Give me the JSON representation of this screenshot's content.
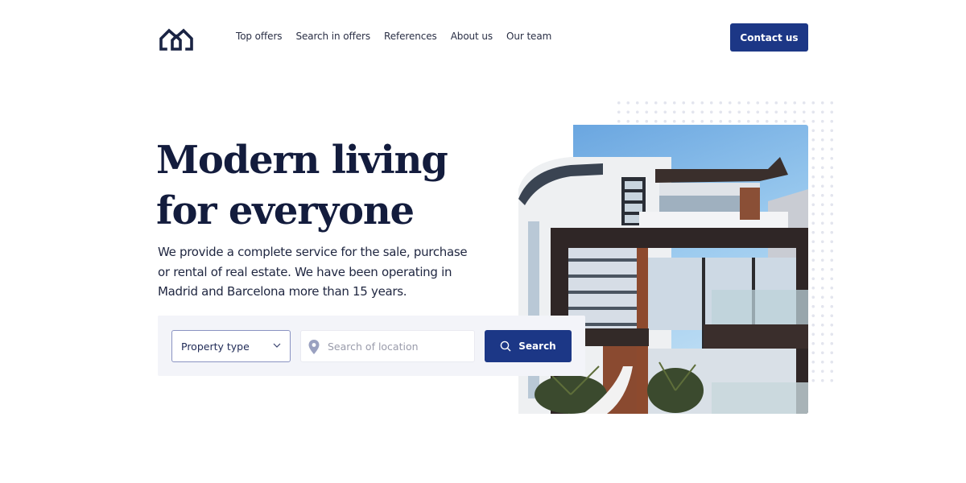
{
  "header": {
    "logo_icon": "house-outline-icon",
    "nav": [
      {
        "label": "Top offers"
      },
      {
        "label": "Search in offers"
      },
      {
        "label": "References"
      },
      {
        "label": "About us"
      },
      {
        "label": "Our team"
      }
    ],
    "contact_label": "Contact us"
  },
  "hero": {
    "title_lines": [
      "Modern living",
      "for everyone"
    ],
    "description_lines": [
      "We provide a complete service for the sale, purchase",
      "or rental of real estate. We have been operating in",
      "Madrid and Barcelona more than 15 years."
    ],
    "image_alt": "Modern white and dark house with glass balconies"
  },
  "search": {
    "property_type": {
      "selected": "Property type",
      "icon": "chevron-down-icon"
    },
    "location": {
      "value": "",
      "placeholder": "Search of location",
      "icon": "map-pin-icon"
    },
    "button_label": "Search",
    "button_icon": "search-icon"
  },
  "colors": {
    "primary": "#1c3786",
    "heading": "#131c3d",
    "panel_bg": "#f3f4f9"
  }
}
